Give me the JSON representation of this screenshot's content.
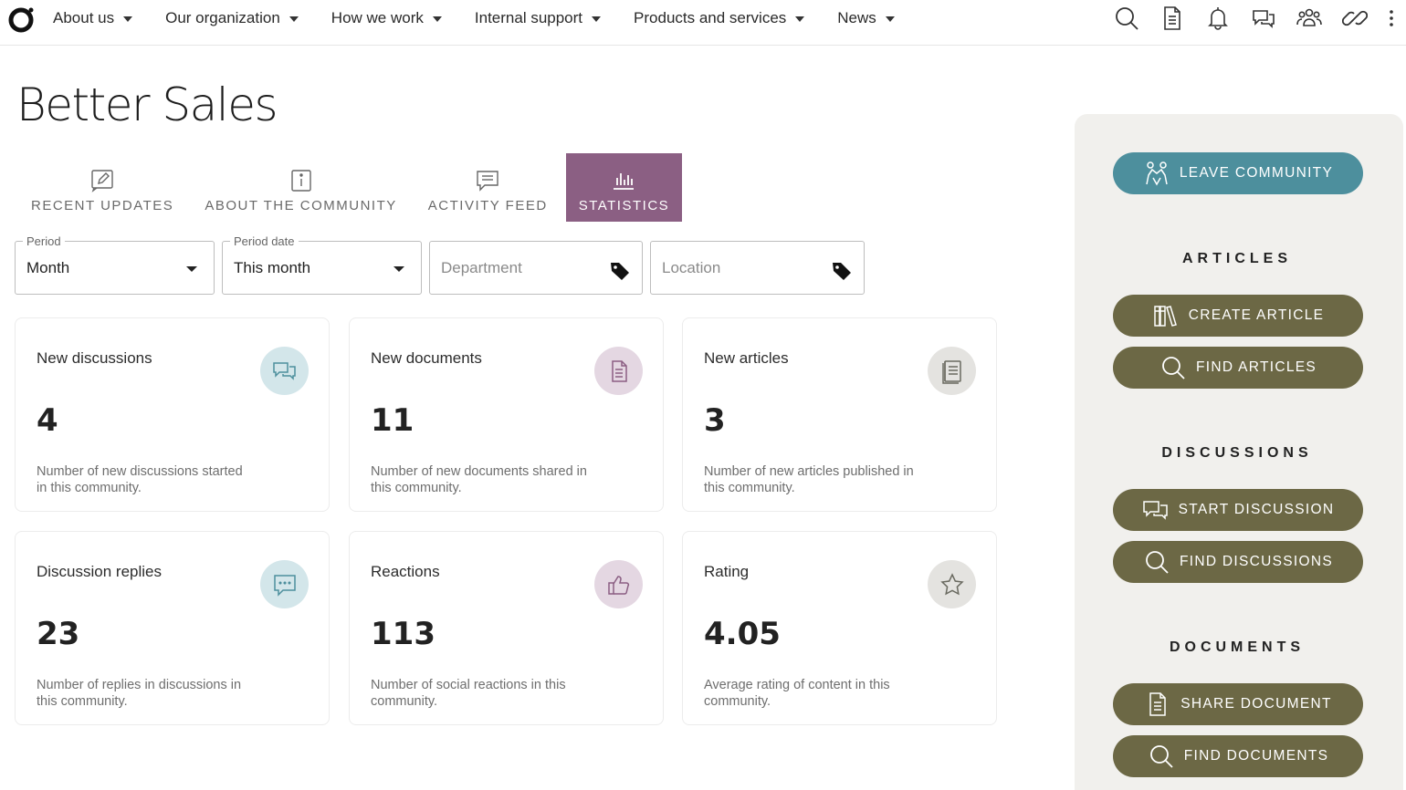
{
  "nav": {
    "items": [
      {
        "label": "About us"
      },
      {
        "label": "Our organization"
      },
      {
        "label": "How we work"
      },
      {
        "label": "Internal support"
      },
      {
        "label": "Products and services"
      },
      {
        "label": "News"
      }
    ],
    "icons": [
      "search-icon",
      "document-icon",
      "bell-icon",
      "chat-icon",
      "people-icon",
      "link-icon",
      "kebab-icon"
    ]
  },
  "page": {
    "title": "Better Sales"
  },
  "tabs": [
    {
      "label": "RECENT UPDATES",
      "icon": "edit-icon",
      "active": false
    },
    {
      "label": "ABOUT THE COMMUNITY",
      "icon": "info-icon",
      "active": false
    },
    {
      "label": "ACTIVITY FEED",
      "icon": "feed-icon",
      "active": false
    },
    {
      "label": "STATISTICS",
      "icon": "stats-icon",
      "active": true
    }
  ],
  "filters": {
    "period": {
      "label": "Period",
      "value": "Month"
    },
    "period_date": {
      "label": "Period date",
      "value": "This month"
    },
    "department": {
      "placeholder": "Department"
    },
    "location": {
      "placeholder": "Location"
    }
  },
  "stats": [
    {
      "title": "New discussions",
      "value": "4",
      "desc": "Number of new discussions started in this community.",
      "icon": "discussion-icon",
      "icon_bg": "#d3e6ea"
    },
    {
      "title": "New documents",
      "value": "11",
      "desc": "Number of new documents shared in this community.",
      "icon": "document-icon",
      "icon_bg": "#e4d7e2"
    },
    {
      "title": "New articles",
      "value": "3",
      "desc": "Number of new articles published in this community.",
      "icon": "article-icon",
      "icon_bg": "#e4e3e0"
    },
    {
      "title": "Discussion replies",
      "value": "23",
      "desc": "Number of replies in discussions in this community.",
      "icon": "reply-icon",
      "icon_bg": "#d3e6ea"
    },
    {
      "title": "Reactions",
      "value": "113",
      "desc": "Number of social reactions in this community.",
      "icon": "thumbs-up-icon",
      "icon_bg": "#e4d7e2"
    },
    {
      "title": "Rating",
      "value": "4.05",
      "desc": "Average rating of content in this community.",
      "icon": "star-icon",
      "icon_bg": "#e4e3e0"
    }
  ],
  "sidebar": {
    "leave_label": "LEAVE COMMUNITY",
    "articles_heading": "ARTICLES",
    "create_article_label": "CREATE ARTICLE",
    "find_articles_label": "FIND ARTICLES",
    "discussions_heading": "DISCUSSIONS",
    "start_discussion_label": "START DISCUSSION",
    "find_discussions_label": "FIND DISCUSSIONS",
    "documents_heading": "DOCUMENTS",
    "share_document_label": "SHARE DOCUMENT",
    "find_documents_label": "FIND DOCUMENTS"
  },
  "colors": {
    "active_tab": "#8b5f83",
    "teal_button": "#4d8f9d",
    "olive_button": "#6c6845",
    "sidebar_bg": "#f1f0ed"
  }
}
